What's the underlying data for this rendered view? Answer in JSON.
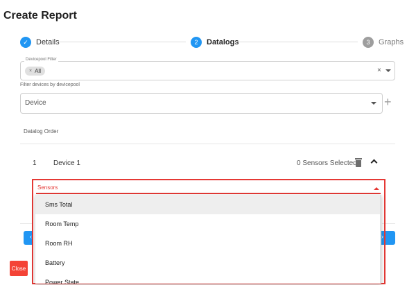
{
  "page": {
    "title": "Create Report"
  },
  "stepper": {
    "steps": [
      {
        "number": "✓",
        "label": "Details",
        "state": "completed"
      },
      {
        "number": "2",
        "label": "Datalogs",
        "state": "active"
      },
      {
        "number": "3",
        "label": "Graphs",
        "state": "inactive"
      }
    ]
  },
  "devicepool_filter": {
    "label": "Devicepool Filter",
    "chip_label": "All",
    "chip_remove": "×",
    "clear": "×",
    "helper_text": "Filter devices by devicepool"
  },
  "device_select": {
    "placeholder": "Device",
    "add": "+"
  },
  "datalog_order": {
    "label": "Datalog Order"
  },
  "device_row": {
    "index": "1",
    "name": "Device 1",
    "sensors_selected": "0 Sensors Selected"
  },
  "sensors_select": {
    "label": "Sensors",
    "options": [
      "Sms Total",
      "Room Temp",
      "Room RH",
      "Battery",
      "Power State"
    ],
    "hovered_index": 0
  },
  "buttons": {
    "close": "Close",
    "back_glyph": "‹",
    "next_glyph": "›"
  },
  "colors": {
    "primary": "#2196f3",
    "error": "#e53935",
    "close": "#f44336",
    "inactive": "#9e9e9e"
  }
}
